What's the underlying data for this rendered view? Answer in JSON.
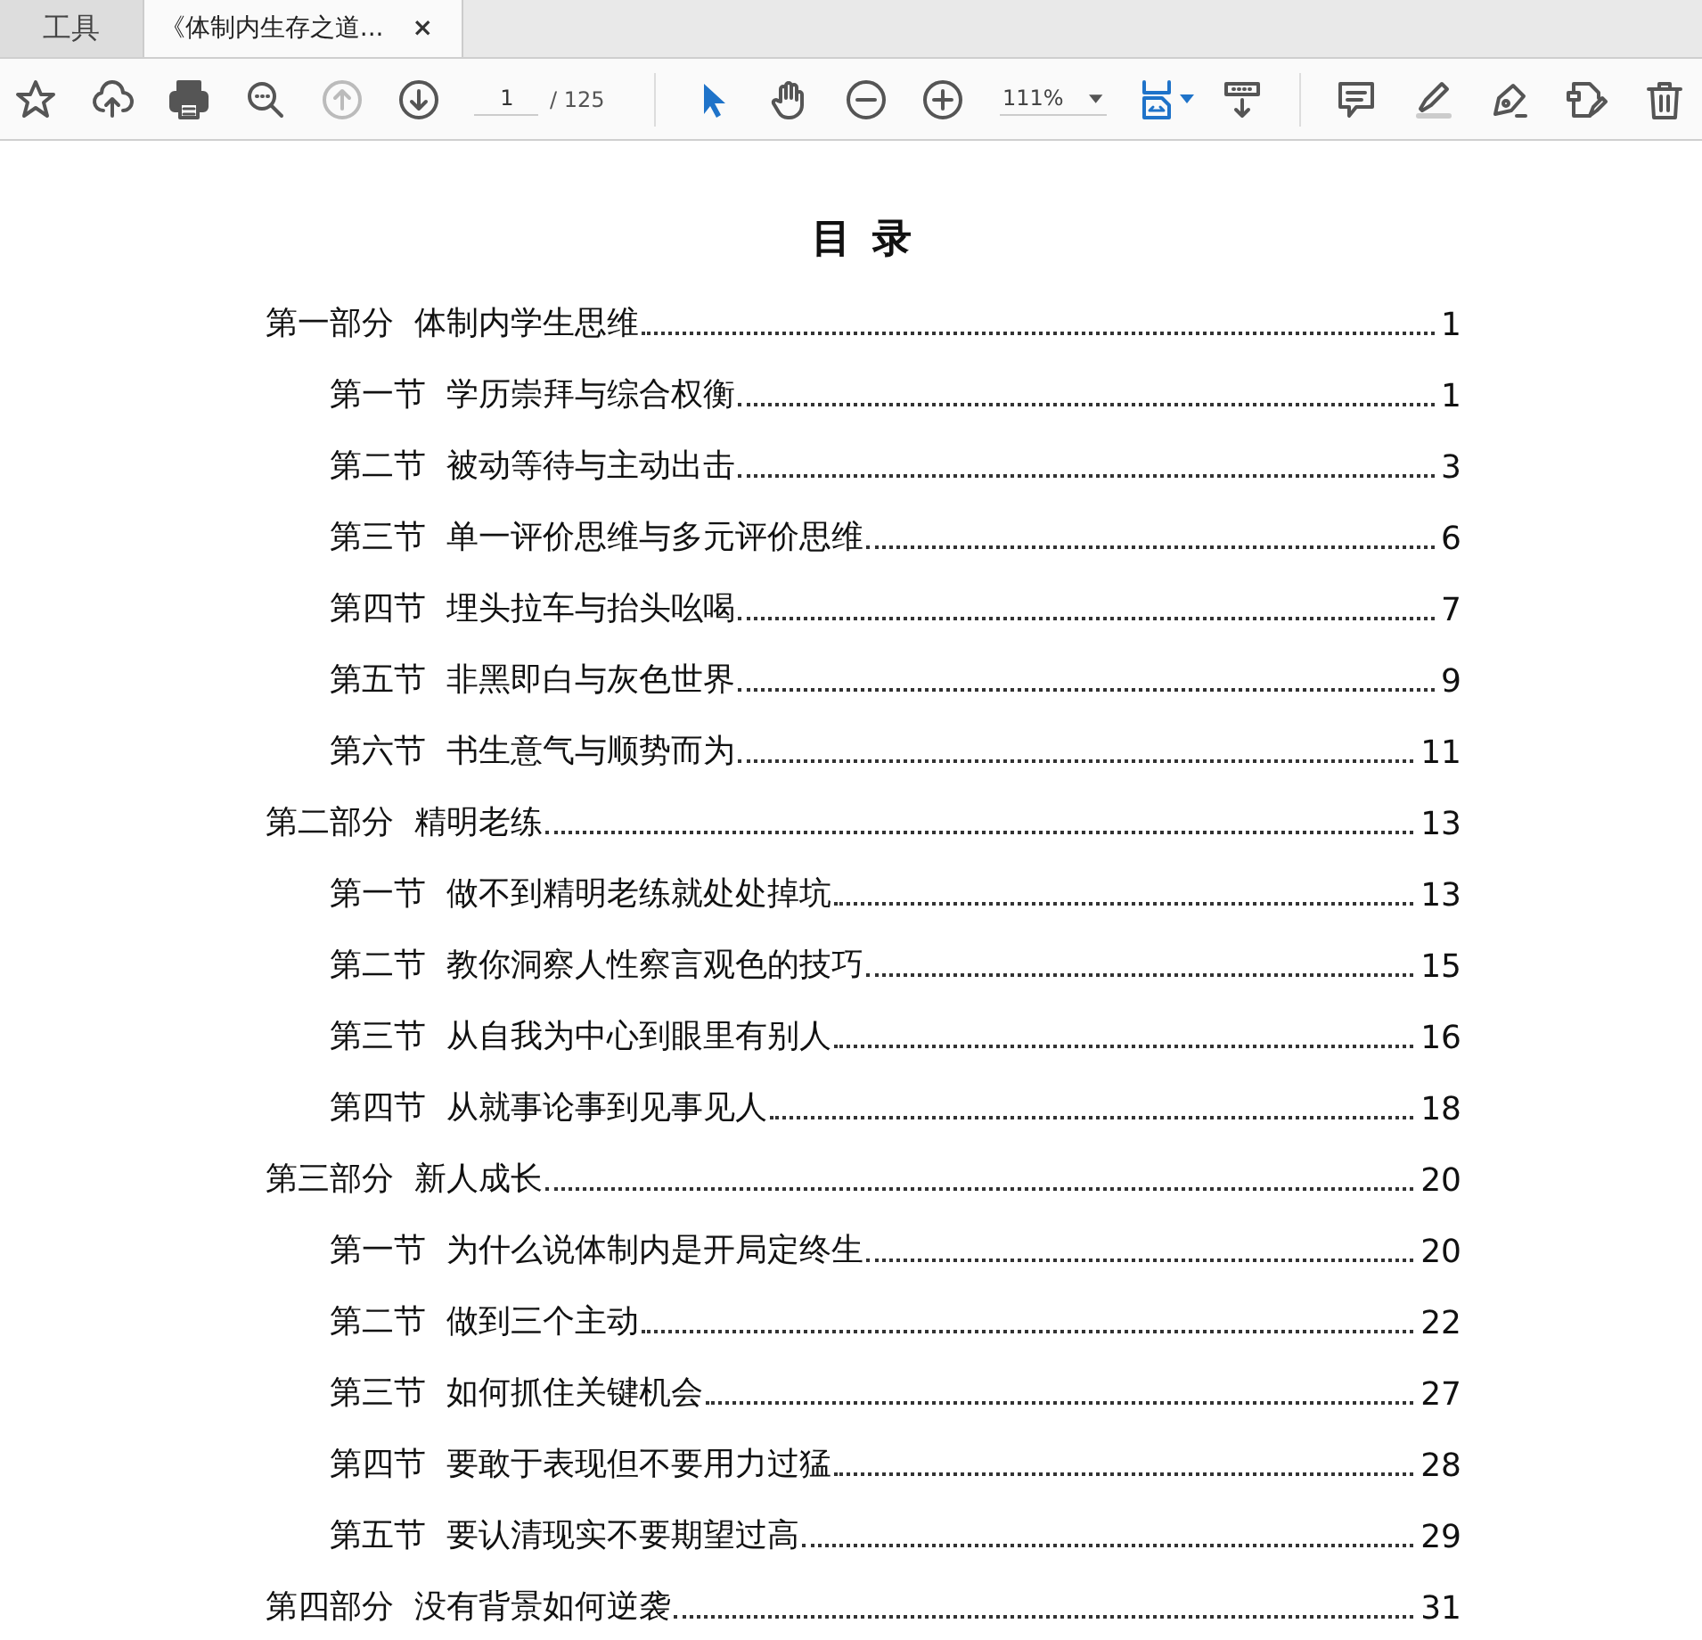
{
  "tabs": [
    {
      "label": "工具",
      "selected": false
    },
    {
      "label": "《体制内生存之道...",
      "selected": true,
      "close": "×"
    }
  ],
  "toolbar": {
    "nav_buttons": [
      {
        "disabled": false
      },
      {
        "disabled": false
      },
      {
        "disabled": false
      },
      {
        "disabled": false
      },
      {
        "disabled": true
      },
      {
        "disabled": false
      }
    ],
    "page_field": {
      "value": "1"
    },
    "page_count": "/ 125",
    "tool_buttons": [
      {
        "selected": true
      },
      {
        "selected": false
      },
      {
        "selected": false
      },
      {
        "selected": false
      }
    ],
    "zoom_field": {
      "value": "111%"
    }
  },
  "document": {
    "title": "目 录",
    "toc": [
      {
        "title": "第一部分  体制内学生思维",
        "page": "1",
        "children": [
          {
            "title": "第一节  学历崇拜与综合权衡",
            "page": "1"
          },
          {
            "title": "第二节  被动等待与主动出击",
            "page": "3"
          },
          {
            "title": "第三节  单一评价思维与多元评价思维",
            "page": "6"
          },
          {
            "title": "第四节  埋头拉车与抬头吆喝",
            "page": "7"
          },
          {
            "title": "第五节  非黑即白与灰色世界",
            "page": "9"
          },
          {
            "title": "第六节  书生意气与顺势而为",
            "page": "11"
          }
        ]
      },
      {
        "title": "第二部分  精明老练",
        "page": "13",
        "children": [
          {
            "title": "第一节  做不到精明老练就处处掉坑",
            "page": "13"
          },
          {
            "title": "第二节  教你洞察人性察言观色的技巧",
            "page": "15"
          },
          {
            "title": "第三节  从自我为中心到眼里有别人",
            "page": "16"
          },
          {
            "title": "第四节  从就事论事到见事见人",
            "page": "18"
          }
        ]
      },
      {
        "title": "第三部分  新人成长",
        "page": "20",
        "children": [
          {
            "title": "第一节  为什么说体制内是开局定终生",
            "page": "20"
          },
          {
            "title": "第二节  做到三个主动",
            "page": "22"
          },
          {
            "title": "第三节  如何抓住关键机会",
            "page": "27"
          },
          {
            "title": "第四节  要敢于表现但不要用力过猛",
            "page": "28"
          },
          {
            "title": "第五节  要认清现实不要期望过高",
            "page": "29"
          }
        ]
      },
      {
        "title": "第四部分  没有背景如何逆袭",
        "page": "31"
      }
    ]
  }
}
